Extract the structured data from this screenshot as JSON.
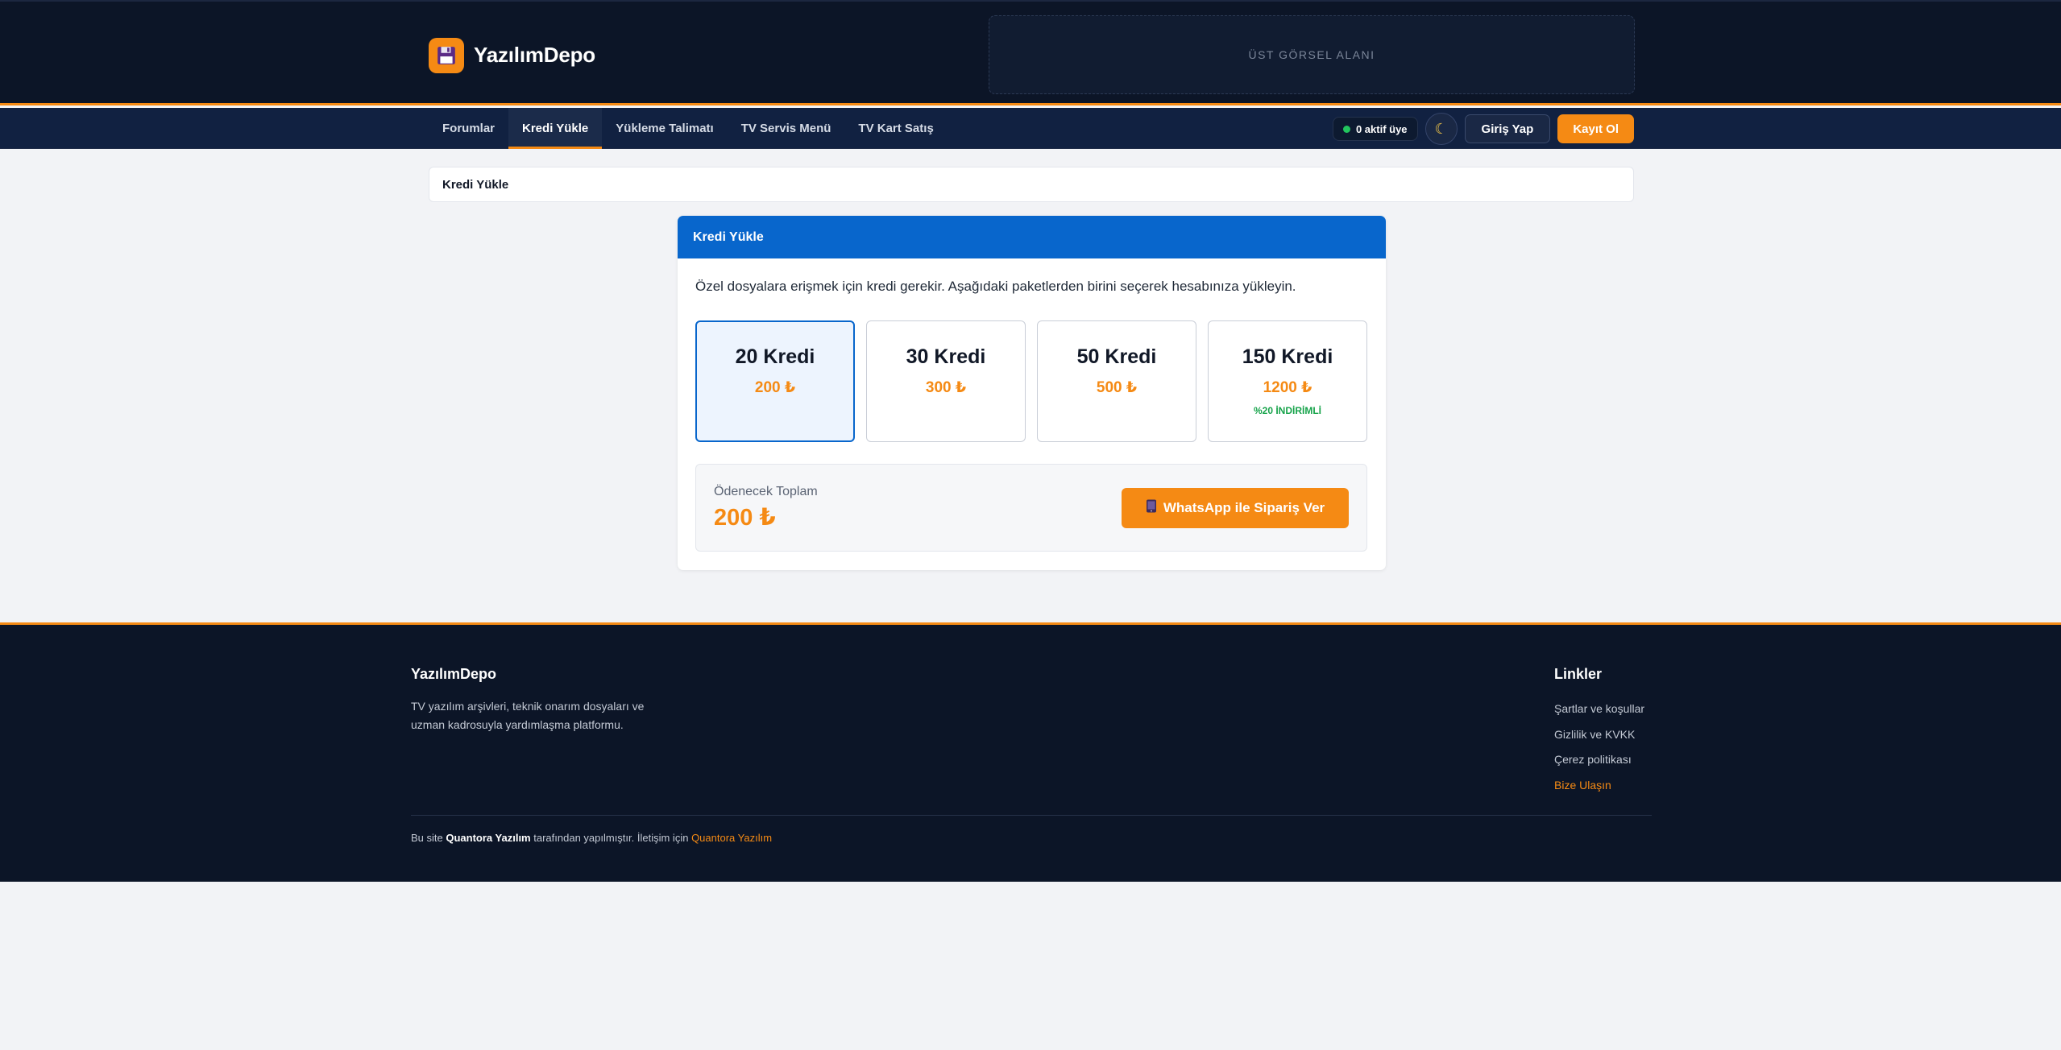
{
  "brand": {
    "name": "YazılımDepo",
    "logo_icon": "floppy-disk-icon",
    "accent_color": "#f58a14"
  },
  "banner": {
    "label": "ÜST GÖRSEL ALANI"
  },
  "nav": {
    "tabs": [
      {
        "label": "Forumlar",
        "active": false
      },
      {
        "label": "Kredi Yükle",
        "active": true
      },
      {
        "label": "Yükleme Talimatı",
        "active": false
      },
      {
        "label": "TV Servis Menü",
        "active": false
      },
      {
        "label": "TV Kart Satış",
        "active": false
      }
    ],
    "online": "0 aktif üye",
    "theme_icon": "moon-icon",
    "login": "Giriş Yap",
    "register": "Kayıt Ol"
  },
  "breadcrumb": {
    "current": "Kredi Yükle"
  },
  "card": {
    "title": "Kredi Yükle",
    "description": "Özel dosyalara erişmek için kredi gerekir. Aşağıdaki paketlerden birini seçerek hesabınıza yükleyin.",
    "packages": [
      {
        "title": "20 Kredi",
        "price": "200 ₺",
        "badge": "",
        "selected": true
      },
      {
        "title": "30 Kredi",
        "price": "300 ₺",
        "badge": "",
        "selected": false
      },
      {
        "title": "50 Kredi",
        "price": "500 ₺",
        "badge": "",
        "selected": false
      },
      {
        "title": "150 Kredi",
        "price": "1200 ₺",
        "badge": "%20 İNDİRİMLİ",
        "selected": false
      }
    ],
    "total_label": "Ödenecek Toplam",
    "total_amount": "200 ₺",
    "order_button": "WhatsApp ile Sipariş Ver",
    "order_icon": "phone-icon"
  },
  "footer": {
    "brand": "YazılımDepo",
    "description": "TV yazılım arşivleri, teknik onarım dosyaları ve uzman kadrosuyla yardımlaşma platformu.",
    "links_title": "Linkler",
    "links": [
      {
        "label": "Şartlar ve koşullar",
        "accent": false
      },
      {
        "label": "Gizlilik ve KVKK",
        "accent": false
      },
      {
        "label": "Çerez politikası",
        "accent": false
      },
      {
        "label": "Bize Ulaşın",
        "accent": true
      }
    ],
    "credit": {
      "prefix": "Bu site",
      "company": "Quantora Yazılım",
      "middle": "tarafından yapılmıştır. İletişim için",
      "link": "Quantora Yazılım"
    }
  }
}
